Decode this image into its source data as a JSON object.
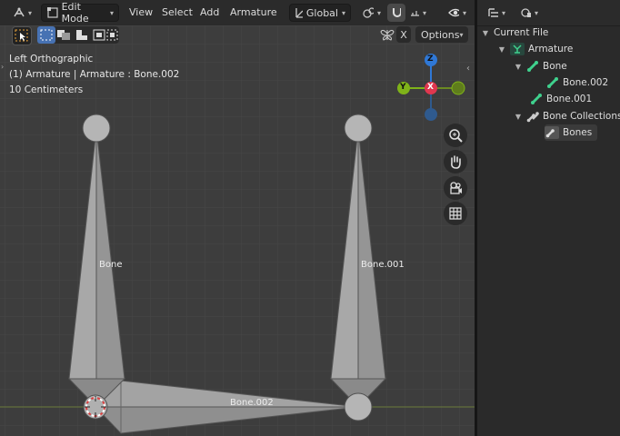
{
  "header": {
    "mode": "Edit Mode",
    "menus": [
      "View",
      "Select",
      "Add",
      "Armature"
    ],
    "orientation": "Global",
    "options": "Options",
    "x_label": "X"
  },
  "overlay": {
    "view_name": "Left Orthographic",
    "object_info": "(1) Armature | Armature : Bone.002",
    "scale": "10 Centimeters"
  },
  "gizmo": {
    "z": "Z",
    "y": "Y",
    "x": "X"
  },
  "bones": {
    "bone": "Bone",
    "bone001": "Bone.001",
    "bone002": "Bone.002"
  },
  "outliner": {
    "current_file": "Current File",
    "armature": "Armature",
    "bone": "Bone",
    "bone002": "Bone.002",
    "bone001": "Bone.001",
    "bone_collections": "Bone Collections",
    "bones": "Bones"
  },
  "colors": {
    "viewport_bg": "#3d3d3d",
    "bone_fill": "#9c9c9c",
    "axis_z": "#2f78d6",
    "axis_y": "#7fb319",
    "axis_x": "#e0374f",
    "select_blue": "#4772b3",
    "outliner_icon": "#3fd18d"
  }
}
